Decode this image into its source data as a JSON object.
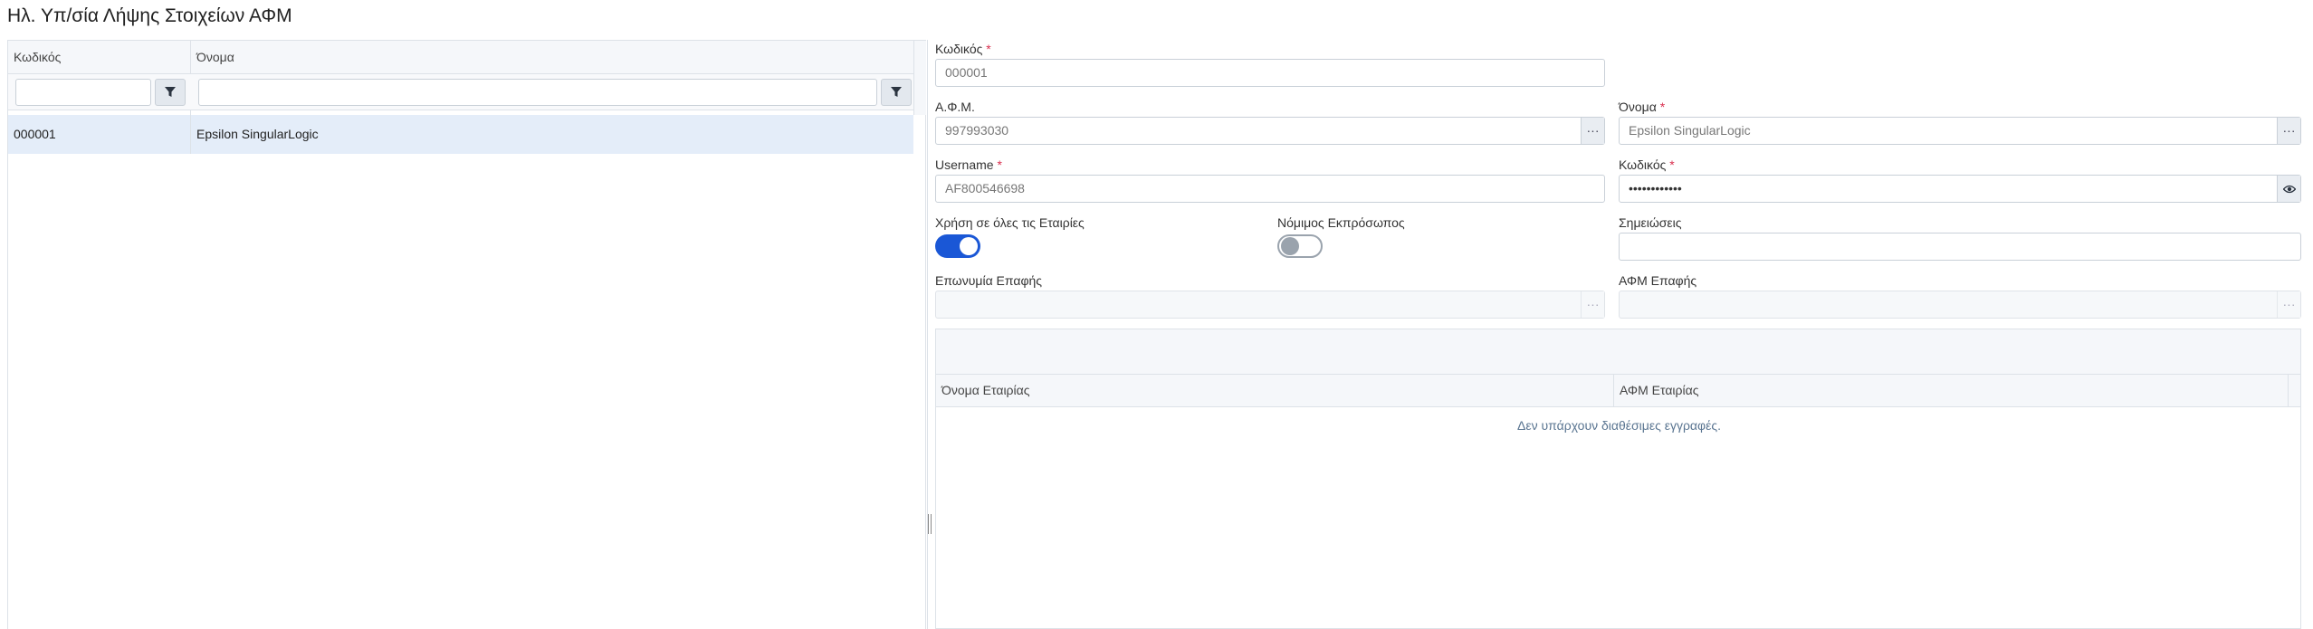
{
  "page": {
    "title": "Ηλ. Υπ/σία Λήψης Στοιχείων ΑΦΜ"
  },
  "grid": {
    "columns": [
      "Κωδικός",
      "Όνομα"
    ],
    "rows": [
      {
        "code": "000001",
        "name": "Epsilon SingularLogic"
      }
    ]
  },
  "form": {
    "code": {
      "label": "Κωδικός",
      "value": "000001"
    },
    "afm": {
      "label": "Α.Φ.Μ.",
      "value": "997993030"
    },
    "name": {
      "label": "Όνομα",
      "value": "Epsilon SingularLogic"
    },
    "username": {
      "label": "Username",
      "value": "AF800546698"
    },
    "password": {
      "label": "Κωδικός",
      "value": "••••••••••••"
    },
    "all_companies": {
      "label": "Χρήση σε όλες τις Εταιρίες",
      "enabled": true
    },
    "legal_rep": {
      "label": "Νόμιμος Εκπρόσωπος",
      "enabled": false
    },
    "notes": {
      "label": "Σημειώσεις",
      "value": ""
    },
    "contact_name": {
      "label": "Επωνυμία Επαφής",
      "value": ""
    },
    "contact_afm": {
      "label": "ΑΦΜ Επαφής",
      "value": ""
    },
    "lookup_glyph": "···"
  },
  "companies": {
    "columns": [
      "Όνομα Εταιρίας",
      "ΑΦΜ Εταιρίας"
    ],
    "empty_message": "Δεν υπάρχουν διαθέσιμες εγγραφές."
  },
  "colors": {
    "accent": "#1a57d6",
    "required": "#d9304f",
    "selected_row": "#e4edf9"
  },
  "icons": {
    "filter": "filter-icon",
    "lookup": "ellipsis-icon",
    "reveal": "eye-icon"
  }
}
